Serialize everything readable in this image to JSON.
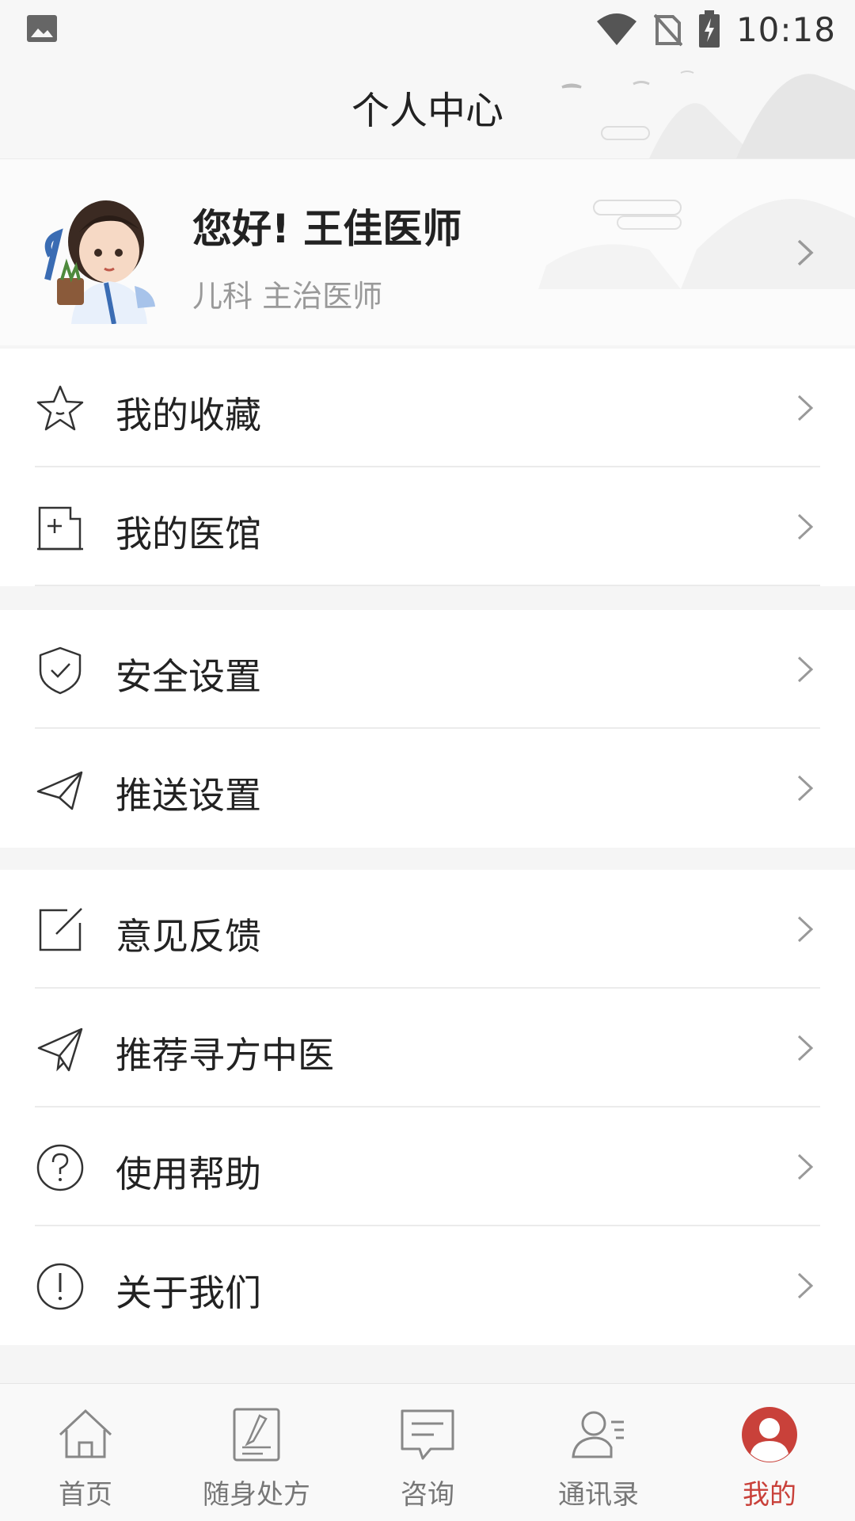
{
  "status_bar": {
    "time": "10:18",
    "icons": [
      "image-icon",
      "wifi-icon",
      "no-sim-icon",
      "battery-charging-icon"
    ]
  },
  "header": {
    "title": "个人中心"
  },
  "profile": {
    "greeting": "您好! 王佳医师",
    "department_title": "儿科 主治医师"
  },
  "menu_groups": [
    [
      {
        "label": "我的收藏",
        "icon": "star-icon"
      },
      {
        "label": "我的医馆",
        "icon": "clinic-icon"
      }
    ],
    [
      {
        "label": "安全设置",
        "icon": "shield-check-icon"
      },
      {
        "label": "推送设置",
        "icon": "send-icon"
      }
    ],
    [
      {
        "label": "意见反馈",
        "icon": "edit-icon"
      },
      {
        "label": "推荐寻方中医",
        "icon": "paper-plane-icon"
      },
      {
        "label": "使用帮助",
        "icon": "question-icon"
      },
      {
        "label": "关于我们",
        "icon": "info-icon"
      }
    ]
  ],
  "tabbar": {
    "tabs": [
      {
        "label": "首页",
        "icon": "home-icon"
      },
      {
        "label": "随身处方",
        "icon": "prescription-icon"
      },
      {
        "label": "咨询",
        "icon": "chat-icon"
      },
      {
        "label": "通讯录",
        "icon": "contacts-icon"
      },
      {
        "label": "我的",
        "icon": "user-icon"
      }
    ],
    "active_index": 4,
    "active_color": "#c9413a"
  }
}
